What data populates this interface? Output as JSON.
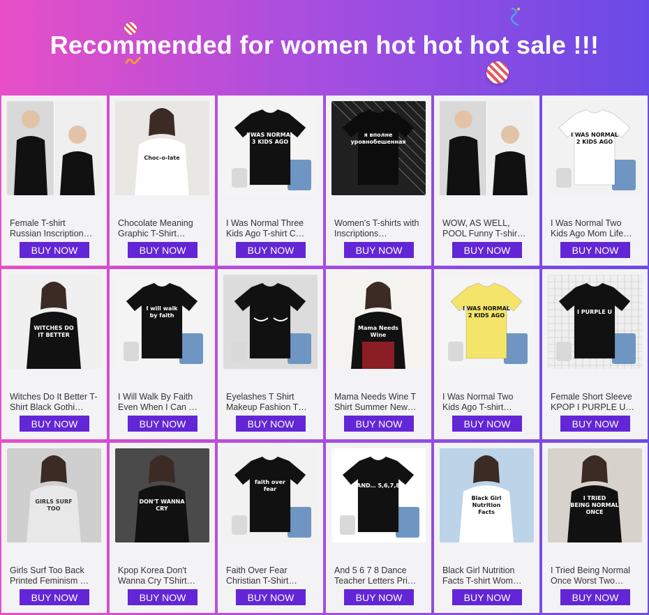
{
  "banner": {
    "title": "Recommended for women hot hot hot sale !!!"
  },
  "button_label": "BUY NOW",
  "colors": {
    "button": "#6226d6",
    "card_bg": "#f3f3f5"
  },
  "products": [
    {
      "title": "Female T-shirt Russian Inscription…",
      "bg": "#ffffff",
      "shirt": "#111111",
      "print": "",
      "ink": "#ffffff",
      "scene": "photo-two"
    },
    {
      "title": "Chocolate Meaning Graphic T-Shirt…",
      "bg": "#e9e7e4",
      "shirt": "#ffffff",
      "print": "Choc-o-late",
      "ink": "#222222",
      "scene": "photo-white"
    },
    {
      "title": "I Was Normal Three Kids Ago T-shirt C…",
      "bg": "#f4f4f4",
      "shirt": "#111111",
      "print": "I WAS NORMAL 3 KIDS AGO",
      "ink": "#ffffff",
      "scene": "flat"
    },
    {
      "title": "Women's T-shirts with Inscriptions…",
      "bg": "#202020",
      "shirt": "#0c0c0c",
      "print": "я вполне уровнобешенная",
      "ink": "#ffffff",
      "scene": "flat-dark"
    },
    {
      "title": "WOW, AS WELL, POOL Funny T-shir…",
      "bg": "#ffffff",
      "shirt": "#111111",
      "print": "",
      "ink": "#ffffff",
      "scene": "photo-two"
    },
    {
      "title": "I Was Normal Two Kids Ago Mom Life…",
      "bg": "#f2f2f2",
      "shirt": "#ffffff",
      "print": "I WAS NORMAL 2 KIDS AGO",
      "ink": "#111111",
      "scene": "flat"
    },
    {
      "title": "Witches Do It Better T-Shirt Black Gothi…",
      "bg": "#f0f0f0",
      "shirt": "#111111",
      "print": "WITCHES DO IT BETTER",
      "ink": "#ffffff",
      "scene": "photo-dark"
    },
    {
      "title": "I Will Walk By Faith Even When I Can …",
      "bg": "#f4f4f4",
      "shirt": "#111111",
      "print": "I will walk by faith",
      "ink": "#ffffff",
      "scene": "flat"
    },
    {
      "title": "Eyelashes T Shirt Makeup Fashion T…",
      "bg": "#dcdcdc",
      "shirt": "#111111",
      "print": "",
      "ink": "#ffffff",
      "scene": "flat-lashes"
    },
    {
      "title": "Mama Needs Wine T Shirt Summer New…",
      "bg": "#f5f3f0",
      "shirt": "#111111",
      "print": "Mama Needs Wine",
      "ink": "#ffffff",
      "scene": "photo-skirt"
    },
    {
      "title": "I Was Normal Two Kids Ago T-shirt…",
      "bg": "#f5f5f5",
      "shirt": "#f4e46a",
      "print": "I WAS NORMAL 2 KIDS AGO",
      "ink": "#111111",
      "scene": "flat"
    },
    {
      "title": "Female Short Sleeve KPOP I PURPLE U…",
      "bg": "#efefef",
      "shirt": "#111111",
      "print": "I PURPLE U",
      "ink": "#ffffff",
      "scene": "flat-grid"
    },
    {
      "title": "Girls Surf Too Back Printed Feminism …",
      "bg": "#cfcfcf",
      "shirt": "#e8e8e8",
      "print": "GIRLS SURF TOO",
      "ink": "#333333",
      "scene": "photo-back"
    },
    {
      "title": "Kpop Korea Don't Wanna Cry TShirt…",
      "bg": "#4a4a4a",
      "shirt": "#111111",
      "print": "DON'T WANNA CRY",
      "ink": "#ffffff",
      "scene": "photo-dark"
    },
    {
      "title": "Faith Over Fear Christian T-Shirt…",
      "bg": "#f2f2f2",
      "shirt": "#111111",
      "print": "faith over fear",
      "ink": "#ffffff",
      "scene": "flat"
    },
    {
      "title": "And 5 6 7 8 Dance Teacher Letters Pri…",
      "bg": "#ffffff",
      "shirt": "#111111",
      "print": "AND… 5,6,7,8",
      "ink": "#ffffff",
      "scene": "flat"
    },
    {
      "title": "Black Girl Nutrition Facts T-shirt Wom…",
      "bg": "#bcd3e8",
      "shirt": "#ffffff",
      "print": "Black Girl Nutrition Facts",
      "ink": "#111111",
      "scene": "photo-white"
    },
    {
      "title": "I Tried Being Normal Once Worst Two…",
      "bg": "#d8d2cc",
      "shirt": "#111111",
      "print": "I TRIED BEING NORMAL ONCE",
      "ink": "#ffffff",
      "scene": "photo-dark"
    }
  ]
}
